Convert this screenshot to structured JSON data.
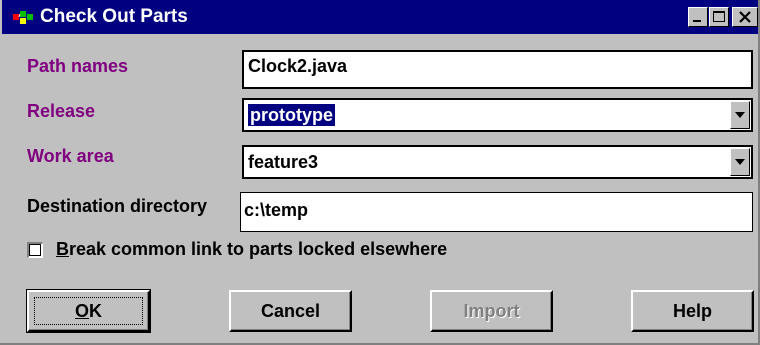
{
  "window": {
    "title": "Check Out Parts",
    "title_bar_color": "#000080",
    "icon": "app-icon"
  },
  "title_buttons": {
    "minimize_icon": "minimize-icon",
    "maximize_icon": "maximize-icon",
    "close_icon": "close-icon"
  },
  "form": {
    "path_names": {
      "label": "Path names",
      "value": "Clock2.java"
    },
    "release": {
      "label": "Release",
      "selected_value": "prototype"
    },
    "work_area": {
      "label": "Work area",
      "selected_value": "feature3"
    },
    "destination_directory": {
      "label": "Destination directory",
      "value": "c:\\temp"
    },
    "break_link": {
      "mnemonic": "B",
      "label_rest": "reak common link to parts locked elsewhere",
      "checked": false
    }
  },
  "buttons": {
    "ok_mnemonic": "O",
    "ok_rest": "K",
    "cancel": "Cancel",
    "import": "Import",
    "help": "Help"
  },
  "colors": {
    "required_label": "#800080",
    "dialog_background": "#c0c0c0",
    "selection": "#000080"
  }
}
